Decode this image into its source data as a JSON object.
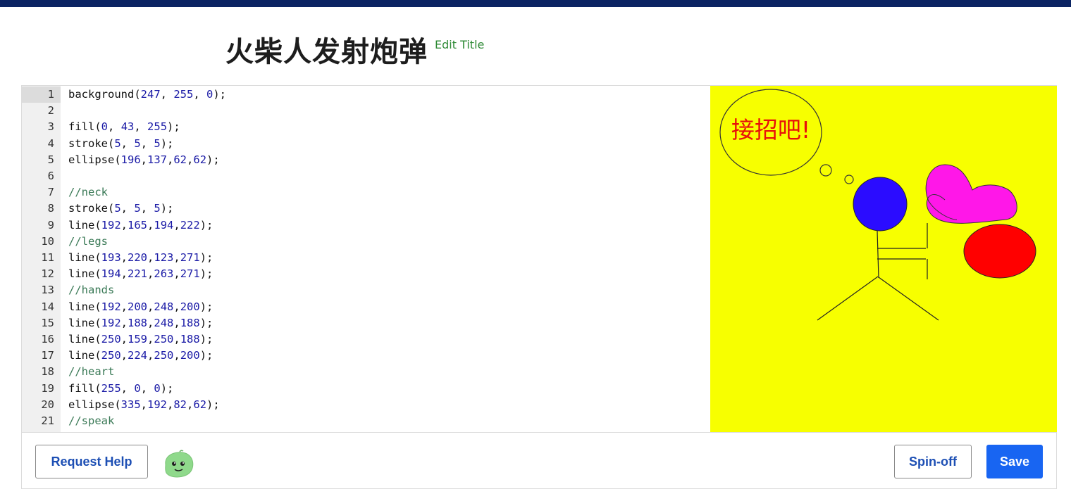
{
  "header": {
    "title": "火柴人发射炮弹",
    "edit_title_label": "Edit Title"
  },
  "editor": {
    "lines": [
      {
        "n": "1",
        "parts": [
          [
            "t",
            "background("
          ],
          [
            "n",
            "247"
          ],
          [
            "t",
            ", "
          ],
          [
            "n",
            "255"
          ],
          [
            "t",
            ", "
          ],
          [
            "n",
            "0"
          ],
          [
            "t",
            ");"
          ]
        ]
      },
      {
        "n": "2",
        "parts": []
      },
      {
        "n": "3",
        "parts": [
          [
            "t",
            "fill("
          ],
          [
            "n",
            "0"
          ],
          [
            "t",
            ", "
          ],
          [
            "n",
            "43"
          ],
          [
            "t",
            ", "
          ],
          [
            "n",
            "255"
          ],
          [
            "t",
            ");"
          ]
        ]
      },
      {
        "n": "4",
        "parts": [
          [
            "t",
            "stroke("
          ],
          [
            "n",
            "5"
          ],
          [
            "t",
            ", "
          ],
          [
            "n",
            "5"
          ],
          [
            "t",
            ", "
          ],
          [
            "n",
            "5"
          ],
          [
            "t",
            ");"
          ]
        ]
      },
      {
        "n": "5",
        "parts": [
          [
            "t",
            "ellipse("
          ],
          [
            "n",
            "196"
          ],
          [
            "t",
            ","
          ],
          [
            "n",
            "137"
          ],
          [
            "t",
            ","
          ],
          [
            "n",
            "62"
          ],
          [
            "t",
            ","
          ],
          [
            "n",
            "62"
          ],
          [
            "t",
            ");"
          ]
        ]
      },
      {
        "n": "6",
        "parts": []
      },
      {
        "n": "7",
        "parts": [
          [
            "c",
            "//neck"
          ]
        ]
      },
      {
        "n": "8",
        "parts": [
          [
            "t",
            "stroke("
          ],
          [
            "n",
            "5"
          ],
          [
            "t",
            ", "
          ],
          [
            "n",
            "5"
          ],
          [
            "t",
            ", "
          ],
          [
            "n",
            "5"
          ],
          [
            "t",
            ");"
          ]
        ]
      },
      {
        "n": "9",
        "parts": [
          [
            "t",
            "line("
          ],
          [
            "n",
            "192"
          ],
          [
            "t",
            ","
          ],
          [
            "n",
            "165"
          ],
          [
            "t",
            ","
          ],
          [
            "n",
            "194"
          ],
          [
            "t",
            ","
          ],
          [
            "n",
            "222"
          ],
          [
            "t",
            ");"
          ]
        ]
      },
      {
        "n": "10",
        "parts": [
          [
            "c",
            "//legs"
          ]
        ]
      },
      {
        "n": "11",
        "parts": [
          [
            "t",
            "line("
          ],
          [
            "n",
            "193"
          ],
          [
            "t",
            ","
          ],
          [
            "n",
            "220"
          ],
          [
            "t",
            ","
          ],
          [
            "n",
            "123"
          ],
          [
            "t",
            ","
          ],
          [
            "n",
            "271"
          ],
          [
            "t",
            ");"
          ]
        ]
      },
      {
        "n": "12",
        "parts": [
          [
            "t",
            "line("
          ],
          [
            "n",
            "194"
          ],
          [
            "t",
            ","
          ],
          [
            "n",
            "221"
          ],
          [
            "t",
            ","
          ],
          [
            "n",
            "263"
          ],
          [
            "t",
            ","
          ],
          [
            "n",
            "271"
          ],
          [
            "t",
            ");"
          ]
        ]
      },
      {
        "n": "13",
        "parts": [
          [
            "c",
            "//hands"
          ]
        ]
      },
      {
        "n": "14",
        "parts": [
          [
            "t",
            "line("
          ],
          [
            "n",
            "192"
          ],
          [
            "t",
            ","
          ],
          [
            "n",
            "200"
          ],
          [
            "t",
            ","
          ],
          [
            "n",
            "248"
          ],
          [
            "t",
            ","
          ],
          [
            "n",
            "200"
          ],
          [
            "t",
            ");"
          ]
        ]
      },
      {
        "n": "15",
        "parts": [
          [
            "t",
            "line("
          ],
          [
            "n",
            "192"
          ],
          [
            "t",
            ","
          ],
          [
            "n",
            "188"
          ],
          [
            "t",
            ","
          ],
          [
            "n",
            "248"
          ],
          [
            "t",
            ","
          ],
          [
            "n",
            "188"
          ],
          [
            "t",
            ");"
          ]
        ]
      },
      {
        "n": "16",
        "parts": [
          [
            "t",
            "line("
          ],
          [
            "n",
            "250"
          ],
          [
            "t",
            ","
          ],
          [
            "n",
            "159"
          ],
          [
            "t",
            ","
          ],
          [
            "n",
            "250"
          ],
          [
            "t",
            ","
          ],
          [
            "n",
            "188"
          ],
          [
            "t",
            ");"
          ]
        ]
      },
      {
        "n": "17",
        "parts": [
          [
            "t",
            "line("
          ],
          [
            "n",
            "250"
          ],
          [
            "t",
            ","
          ],
          [
            "n",
            "224"
          ],
          [
            "t",
            ","
          ],
          [
            "n",
            "250"
          ],
          [
            "t",
            ","
          ],
          [
            "n",
            "200"
          ],
          [
            "t",
            ");"
          ]
        ]
      },
      {
        "n": "18",
        "parts": [
          [
            "c",
            "//heart"
          ]
        ]
      },
      {
        "n": "19",
        "parts": [
          [
            "t",
            "fill("
          ],
          [
            "n",
            "255"
          ],
          [
            "t",
            ", "
          ],
          [
            "n",
            "0"
          ],
          [
            "t",
            ", "
          ],
          [
            "n",
            "0"
          ],
          [
            "t",
            ");"
          ]
        ]
      },
      {
        "n": "20",
        "parts": [
          [
            "t",
            "ellipse("
          ],
          [
            "n",
            "335"
          ],
          [
            "t",
            ","
          ],
          [
            "n",
            "192"
          ],
          [
            "t",
            ","
          ],
          [
            "n",
            "82"
          ],
          [
            "t",
            ","
          ],
          [
            "n",
            "62"
          ],
          [
            "t",
            ");"
          ]
        ]
      },
      {
        "n": "21",
        "parts": [
          [
            "c",
            "//speak"
          ]
        ]
      }
    ]
  },
  "canvas": {
    "background": "#f7ff00",
    "speech_text": "接招吧!",
    "speech_color": "#e8100a",
    "head_color": "#2b0cff",
    "heart_color": "#ff17e8",
    "ball_color": "#ff0000"
  },
  "footer": {
    "request_help_label": "Request Help",
    "spinoff_label": "Spin-off",
    "save_label": "Save",
    "avatar_icon": "green-blob-avatar-icon"
  },
  "colors": {
    "topbar": "#0b2463",
    "primary": "#1865f2",
    "title_link": "#2e8a35"
  }
}
